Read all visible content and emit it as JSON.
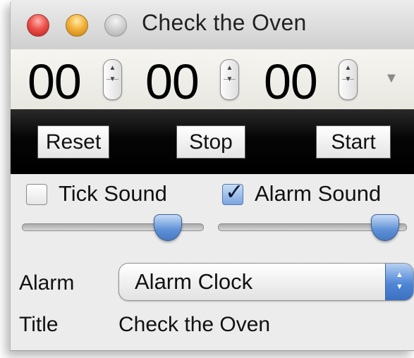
{
  "window": {
    "title": "Check the Oven"
  },
  "timer": {
    "hours": "00",
    "minutes": "00",
    "seconds": "00"
  },
  "controls": {
    "reset_label": "Reset",
    "stop_label": "Stop",
    "start_label": "Start"
  },
  "settings": {
    "tick_sound_label": "Tick Sound",
    "tick_sound_checked": false,
    "alarm_sound_label": "Alarm Sound",
    "alarm_sound_checked": true,
    "tick_volume": 0.8,
    "alarm_volume": 0.9,
    "alarm_label": "Alarm",
    "alarm_value": "Alarm Clock",
    "title_label": "Title",
    "title_value": "Check the Oven"
  },
  "colors": {
    "accent": "#4f86d6",
    "band": "#000000",
    "window_bg": "#ececec"
  },
  "icons": {
    "stepper": "stepper-icon",
    "menu": "dropdown-triangle-icon",
    "checkmark": "checkmark-icon",
    "popup": "popup-arrows-icon"
  }
}
